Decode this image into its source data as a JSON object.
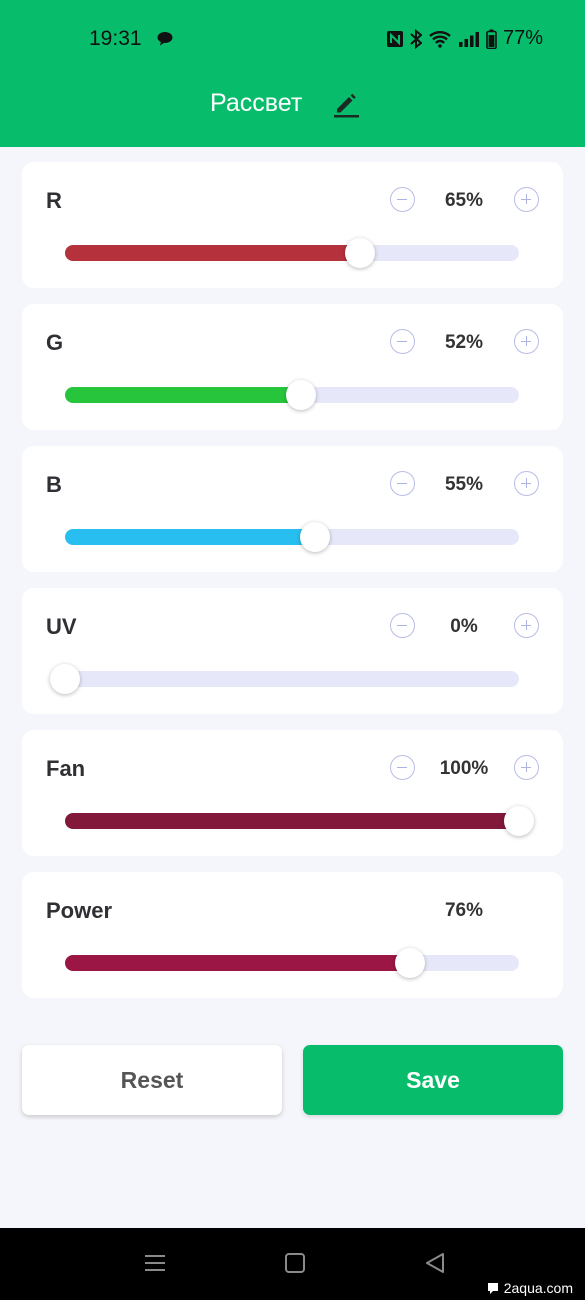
{
  "status_bar": {
    "time": "19:31",
    "battery": "77%",
    "icons": [
      "message-icon",
      "nfc-icon",
      "bluetooth-icon",
      "wifi-icon",
      "signal-icon",
      "battery-icon"
    ]
  },
  "header": {
    "title": "Рассвет",
    "edit_icon": "pencil-icon"
  },
  "colors": {
    "accent": "#07bd6b",
    "track": "#e6e8f9",
    "r": "#b5323d",
    "g": "#27c53c",
    "b": "#28bff0",
    "uv": "#e6e8f9",
    "fan": "#82193a",
    "power": "#9c1645"
  },
  "channels": [
    {
      "id": "r",
      "label": "R",
      "value_text": "65%",
      "value": 0.65,
      "has_stepper": true
    },
    {
      "id": "g",
      "label": "G",
      "value_text": "52%",
      "value": 0.52,
      "has_stepper": true
    },
    {
      "id": "b",
      "label": "B",
      "value_text": "55%",
      "value": 0.55,
      "has_stepper": true
    },
    {
      "id": "uv",
      "label": "UV",
      "value_text": "0%",
      "value": 0.0,
      "has_stepper": true
    },
    {
      "id": "fan",
      "label": "Fan",
      "value_text": "100%",
      "value": 1.0,
      "has_stepper": true
    },
    {
      "id": "power",
      "label": "Power",
      "value_text": "76%",
      "value": 0.76,
      "has_stepper": false
    }
  ],
  "buttons": {
    "reset": "Reset",
    "save": "Save"
  },
  "navbar": {
    "icons": [
      "menu-icon",
      "home-square-icon",
      "back-triangle-icon"
    ]
  },
  "watermark": "2aqua.com"
}
